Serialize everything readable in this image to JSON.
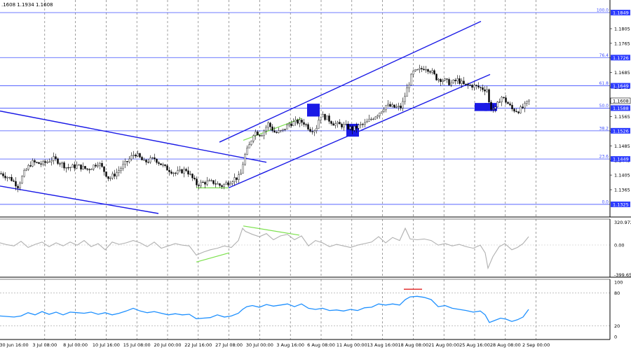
{
  "header": {
    "ohlc_text": ".1608 1.1934 1.1608"
  },
  "chart_data": [
    {
      "type": "candlestick",
      "panel": "price",
      "ylim": [
        1.13,
        1.187
      ],
      "y_ticks": [
        "1.1805",
        "1.1765",
        "1.1725",
        "1.1685",
        "1.1645",
        "1.1605",
        "1.1565",
        "1.1525",
        "1.1485",
        "1.1445",
        "1.1405",
        "1.1365"
      ],
      "fib_levels": [
        {
          "pct": "100.0",
          "price": "1.1849"
        },
        {
          "pct": "76.4",
          "price": "1.1726"
        },
        {
          "pct": "61.8",
          "price": "1.1649"
        },
        {
          "pct": "50.0",
          "price": "1.1588"
        },
        {
          "pct": "38.2",
          "price": "1.1526"
        },
        {
          "pct": "23.6",
          "price": "1.1449"
        },
        {
          "pct": "0.0",
          "price": "1.1325"
        }
      ],
      "current_price": "1.1608",
      "x_labels": [
        "30 Jun 16:00",
        "3 Jul 08:00",
        "8 Jul 00:00",
        "10 Jul 16:00",
        "15 Jul 08:00",
        "20 Jul 00:00",
        "22 Jul 16:00",
        "27 Jul 08:00",
        "30 Jul 00:00",
        "3 Aug 16:00",
        "6 Aug 08:00",
        "11 Aug 00:00",
        "13 Aug 16:00",
        "18 Aug 08:00",
        "21 Aug 00:00",
        "25 Aug 16:00",
        "28 Aug 08:00",
        "2 Sep 00:00"
      ],
      "series_path": [
        [
          0,
          1.141
        ],
        [
          15,
          1.1395
        ],
        [
          25,
          1.1375
        ],
        [
          35,
          1.1415
        ],
        [
          45,
          1.144
        ],
        [
          60,
          1.1435
        ],
        [
          75,
          1.145
        ],
        [
          85,
          1.144
        ],
        [
          95,
          1.1425
        ],
        [
          110,
          1.143
        ],
        [
          125,
          1.142
        ],
        [
          140,
          1.144
        ],
        [
          155,
          1.1395
        ],
        [
          165,
          1.141
        ],
        [
          180,
          1.144
        ],
        [
          192,
          1.1465
        ],
        [
          205,
          1.144
        ],
        [
          220,
          1.145
        ],
        [
          235,
          1.1425
        ],
        [
          250,
          1.141
        ],
        [
          265,
          1.142
        ],
        [
          280,
          1.138
        ],
        [
          292,
          1.1385
        ],
        [
          305,
          1.1385
        ],
        [
          315,
          1.1375
        ],
        [
          325,
          1.1385
        ],
        [
          333,
          1.1395
        ],
        [
          342,
          1.14
        ],
        [
          348,
          1.1455
        ],
        [
          356,
          1.149
        ],
        [
          362,
          1.1525
        ],
        [
          372,
          1.1515
        ],
        [
          382,
          1.1545
        ],
        [
          392,
          1.152
        ],
        [
          402,
          1.1525
        ],
        [
          412,
          1.1545
        ],
        [
          422,
          1.155
        ],
        [
          432,
          1.155
        ],
        [
          442,
          1.153
        ],
        [
          450,
          1.153
        ],
        [
          456,
          1.157
        ],
        [
          466,
          1.156
        ],
        [
          476,
          1.1545
        ],
        [
          490,
          1.154
        ],
        [
          503,
          1.153
        ],
        [
          512,
          1.154
        ],
        [
          520,
          1.1545
        ],
        [
          530,
          1.156
        ],
        [
          540,
          1.1575
        ],
        [
          550,
          1.1595
        ],
        [
          562,
          1.159
        ],
        [
          572,
          1.159
        ],
        [
          580,
          1.164
        ],
        [
          588,
          1.1685
        ],
        [
          596,
          1.169
        ],
        [
          606,
          1.17
        ],
        [
          614,
          1.169
        ],
        [
          622,
          1.167
        ],
        [
          632,
          1.1665
        ],
        [
          642,
          1.1655
        ],
        [
          652,
          1.1665
        ],
        [
          662,
          1.165
        ],
        [
          672,
          1.165
        ],
        [
          682,
          1.1645
        ],
        [
          690,
          1.164
        ],
        [
          694,
          1.164
        ],
        [
          698,
          1.159
        ],
        [
          706,
          1.1585
        ],
        [
          714,
          1.162
        ],
        [
          722,
          1.1605
        ],
        [
          730,
          1.1585
        ],
        [
          738,
          1.158
        ],
        [
          746,
          1.159
        ],
        [
          754,
          1.1608
        ]
      ],
      "annotations": [
        {
          "kind": "channel",
          "from": [
            313,
            1.1495
          ],
          "to": [
            686,
            1.1825
          ]
        },
        {
          "kind": "channel",
          "from": [
            326,
            1.137
          ],
          "to": [
            699,
            1.168
          ]
        },
        {
          "kind": "trendline",
          "from": [
            0,
            1.158
          ],
          "to": [
            380,
            1.144
          ]
        },
        {
          "kind": "trendline",
          "from": [
            0,
            1.1375
          ],
          "to": [
            226,
            1.13
          ]
        },
        {
          "kind": "divergence",
          "color": "#7be14b",
          "from": [
            280,
            1.137
          ],
          "to": [
            326,
            1.137
          ]
        },
        {
          "kind": "divergence",
          "color": "#7be14b",
          "from": [
            347,
            1.15
          ],
          "to": [
            430,
            1.156
          ]
        }
      ],
      "boxes": [
        {
          "x": 447,
          "price_top": 1.16,
          "price_bottom": 1.1565
        },
        {
          "x": 503,
          "price_top": 1.1545,
          "price_bottom": 1.151
        },
        {
          "x": 686,
          "price_top": 1.1602,
          "price_bottom": 1.158
        },
        {
          "x": 700,
          "price_top": 1.1602,
          "price_bottom": 1.158
        }
      ]
    },
    {
      "type": "line",
      "panel": "cci",
      "ylim": [
        -399.652,
        320.9724
      ],
      "y_labels": [
        "320.9724",
        "0.00",
        "-399.652"
      ],
      "series": [
        {
          "name": "",
          "values": [
            [
              0,
              30
            ],
            [
              10,
              5
            ],
            [
              20,
              -10
            ],
            [
              30,
              50
            ],
            [
              40,
              -30
            ],
            [
              50,
              10
            ],
            [
              60,
              40
            ],
            [
              70,
              -20
            ],
            [
              80,
              30
            ],
            [
              90,
              -10
            ],
            [
              100,
              40
            ],
            [
              110,
              0
            ],
            [
              120,
              60
            ],
            [
              130,
              -20
            ],
            [
              140,
              20
            ],
            [
              150,
              -60
            ],
            [
              160,
              40
            ],
            [
              170,
              10
            ],
            [
              180,
              30
            ],
            [
              190,
              60
            ],
            [
              200,
              30
            ],
            [
              210,
              -20
            ],
            [
              220,
              40
            ],
            [
              230,
              -40
            ],
            [
              240,
              -10
            ],
            [
              250,
              20
            ],
            [
              260,
              0
            ],
            [
              270,
              -10
            ],
            [
              280,
              -130
            ],
            [
              290,
              -90
            ],
            [
              300,
              -60
            ],
            [
              310,
              -40
            ],
            [
              320,
              -10
            ],
            [
              330,
              -30
            ],
            [
              340,
              60
            ],
            [
              346,
              220
            ],
            [
              350,
              180
            ],
            [
              360,
              140
            ],
            [
              370,
              110
            ],
            [
              380,
              150
            ],
            [
              390,
              70
            ],
            [
              400,
              120
            ],
            [
              410,
              140
            ],
            [
              420,
              70
            ],
            [
              430,
              120
            ],
            [
              440,
              -10
            ],
            [
              450,
              60
            ],
            [
              460,
              30
            ],
            [
              470,
              -20
            ],
            [
              480,
              10
            ],
            [
              490,
              -10
            ],
            [
              500,
              -30
            ],
            [
              510,
              0
            ],
            [
              520,
              20
            ],
            [
              530,
              40
            ],
            [
              540,
              110
            ],
            [
              550,
              30
            ],
            [
              560,
              100
            ],
            [
              570,
              60
            ],
            [
              578,
              220
            ],
            [
              585,
              80
            ],
            [
              595,
              70
            ],
            [
              605,
              80
            ],
            [
              615,
              60
            ],
            [
              625,
              0
            ],
            [
              635,
              20
            ],
            [
              645,
              -10
            ],
            [
              655,
              10
            ],
            [
              665,
              -20
            ],
            [
              675,
              -40
            ],
            [
              685,
              0
            ],
            [
              692,
              -100
            ],
            [
              696,
              -300
            ],
            [
              703,
              -150
            ],
            [
              712,
              -20
            ],
            [
              720,
              20
            ],
            [
              730,
              -60
            ],
            [
              738,
              -30
            ],
            [
              746,
              20
            ],
            [
              754,
              110
            ]
          ]
        }
      ],
      "annotations": [
        {
          "kind": "divergence",
          "color": "#7be14b",
          "from": [
            280,
            -220
          ],
          "to": [
            327,
            -100
          ]
        },
        {
          "kind": "divergence",
          "color": "#7be14b",
          "from": [
            347,
            250
          ],
          "to": [
            427,
            130
          ]
        }
      ]
    },
    {
      "type": "line",
      "panel": "rsi",
      "ylim": [
        0,
        100
      ],
      "y_labels": [
        "100",
        "80",
        "20",
        "0"
      ],
      "levels": [
        80,
        20
      ],
      "series": [
        {
          "name": "",
          "values": [
            [
              0,
              38
            ],
            [
              10,
              37
            ],
            [
              20,
              36
            ],
            [
              30,
              38
            ],
            [
              40,
              44
            ],
            [
              50,
              40
            ],
            [
              60,
              46
            ],
            [
              70,
              41
            ],
            [
              80,
              45
            ],
            [
              90,
              40
            ],
            [
              100,
              45
            ],
            [
              110,
              44
            ],
            [
              120,
              43
            ],
            [
              130,
              45
            ],
            [
              140,
              41
            ],
            [
              150,
              44
            ],
            [
              160,
              40
            ],
            [
              170,
              43
            ],
            [
              180,
              47
            ],
            [
              190,
              52
            ],
            [
              200,
              47
            ],
            [
              210,
              44
            ],
            [
              220,
              46
            ],
            [
              230,
              43
            ],
            [
              240,
              40
            ],
            [
              250,
              42
            ],
            [
              260,
              40
            ],
            [
              270,
              41
            ],
            [
              280,
              33
            ],
            [
              290,
              34
            ],
            [
              300,
              35
            ],
            [
              310,
              40
            ],
            [
              320,
              36
            ],
            [
              330,
              38
            ],
            [
              340,
              43
            ],
            [
              346,
              50
            ],
            [
              352,
              55
            ],
            [
              360,
              57
            ],
            [
              370,
              54
            ],
            [
              380,
              59
            ],
            [
              390,
              56
            ],
            [
              400,
              58
            ],
            [
              410,
              60
            ],
            [
              420,
              55
            ],
            [
              430,
              60
            ],
            [
              440,
              52
            ],
            [
              450,
              50
            ],
            [
              460,
              52
            ],
            [
              470,
              48
            ],
            [
              480,
              49
            ],
            [
              490,
              47
            ],
            [
              500,
              50
            ],
            [
              510,
              48
            ],
            [
              520,
              53
            ],
            [
              530,
              54
            ],
            [
              540,
              60
            ],
            [
              550,
              58
            ],
            [
              560,
              60
            ],
            [
              570,
              58
            ],
            [
              578,
              68
            ],
            [
              585,
              73
            ],
            [
              595,
              74
            ],
            [
              605,
              72
            ],
            [
              615,
              68
            ],
            [
              625,
              55
            ],
            [
              635,
              57
            ],
            [
              645,
              52
            ],
            [
              655,
              50
            ],
            [
              665,
              48
            ],
            [
              675,
              45
            ],
            [
              685,
              47
            ],
            [
              692,
              40
            ],
            [
              698,
              26
            ],
            [
              706,
              30
            ],
            [
              714,
              34
            ],
            [
              722,
              32
            ],
            [
              730,
              28
            ],
            [
              738,
              31
            ],
            [
              746,
              36
            ],
            [
              754,
              50
            ]
          ]
        }
      ],
      "annotations": [
        {
          "kind": "overbought-mark",
          "color": "#e02020",
          "from": [
            576,
            87
          ],
          "to": [
            602,
            87
          ]
        }
      ]
    }
  ]
}
